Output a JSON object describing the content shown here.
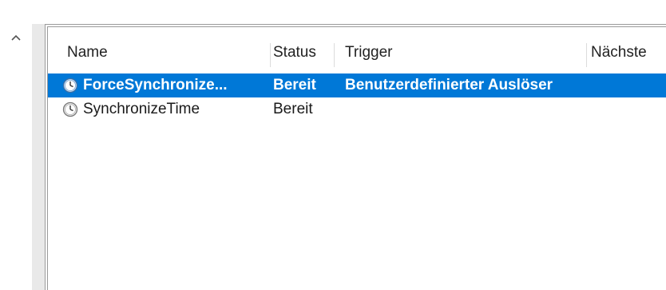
{
  "scrollbar": {
    "up_glyph": "^"
  },
  "table": {
    "columns": [
      {
        "label": "Name"
      },
      {
        "label": "Status"
      },
      {
        "label": "Trigger"
      },
      {
        "label": "Nächste"
      }
    ],
    "rows": [
      {
        "name": "ForceSynchronize...",
        "status": "Bereit",
        "trigger": "Benutzerdefinierter Auslöser",
        "icon": "clock-icon",
        "selected": true
      },
      {
        "name": "SynchronizeTime",
        "status": "Bereit",
        "trigger": "",
        "icon": "clock-icon",
        "selected": false
      }
    ]
  },
  "colors": {
    "selection": "#0078d7"
  }
}
